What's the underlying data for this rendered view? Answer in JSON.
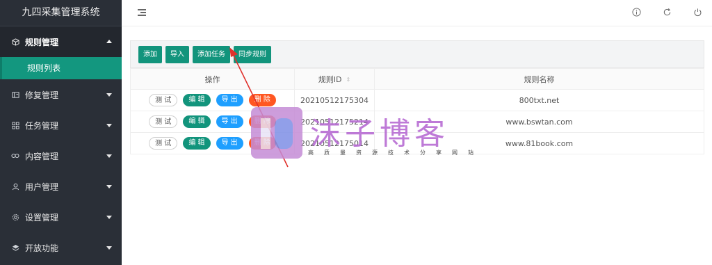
{
  "brand": "九四采集管理系统",
  "sidebar": {
    "groups": [
      {
        "label": "规则管理",
        "icon": "cube-icon",
        "open": true,
        "children": [
          {
            "label": "规则列表"
          }
        ]
      },
      {
        "label": "修复管理",
        "icon": "repair-icon"
      },
      {
        "label": "任务管理",
        "icon": "task-icon"
      },
      {
        "label": "内容管理",
        "icon": "link-icon"
      },
      {
        "label": "用户管理",
        "icon": "user-icon"
      },
      {
        "label": "设置管理",
        "icon": "gear-icon"
      },
      {
        "label": "开放功能",
        "icon": "layers-icon"
      }
    ]
  },
  "topbar": {
    "icons": [
      "info-icon",
      "refresh-icon",
      "power-icon"
    ]
  },
  "toolbar": {
    "buttons": [
      "添加",
      "导入",
      "添加任务",
      "同步规则"
    ]
  },
  "table": {
    "headers": {
      "operation": "操作",
      "rule_id": "规则ID",
      "rule_name": "规则名称"
    },
    "actions": {
      "test": "测 试",
      "edit": "编 辑",
      "export": "导 出",
      "delete": "删 除"
    },
    "rows": [
      {
        "id": "20210512175304",
        "name": "800txt.net"
      },
      {
        "id": "20210512175214",
        "name": "www.bswtan.com"
      },
      {
        "id": "20210512175014",
        "name": "www.81book.com"
      }
    ]
  },
  "watermark": {
    "title": "沫子博客",
    "subtitle": "高质量资源技术分享网站"
  }
}
